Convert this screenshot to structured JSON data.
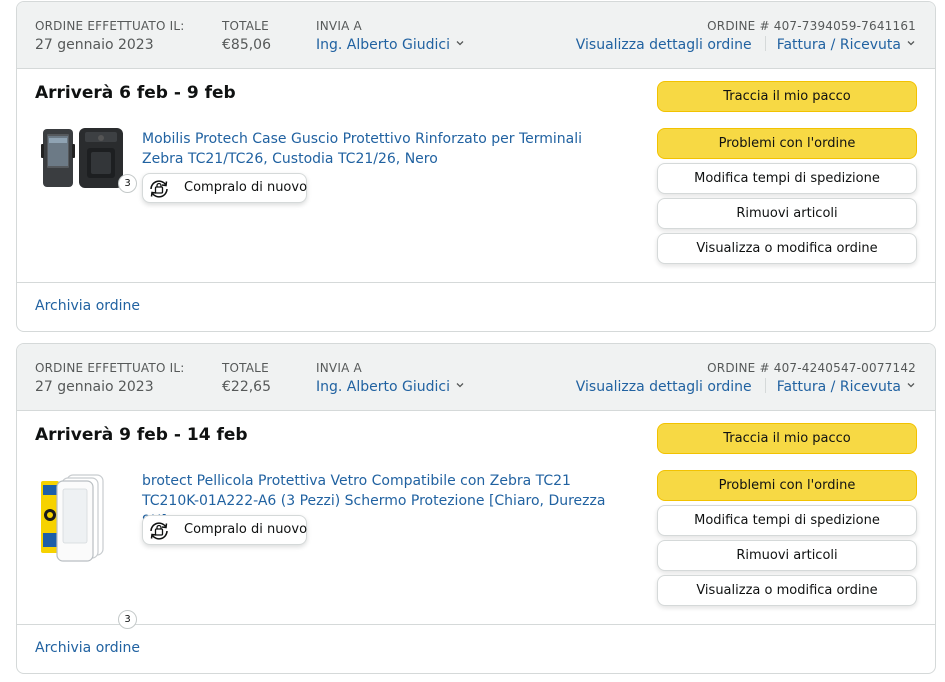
{
  "labels": {
    "order_placed": "ORDINE EFFETTUATO IL:",
    "total": "TOTALE",
    "ship_to": "INVIA A",
    "order_number_prefix": "ORDINE #"
  },
  "orders": [
    {
      "date": "27 gennaio 2023",
      "total": "€85,06",
      "recipient": "Ing. Alberto Giudici",
      "order_number": "ORDINE # 407-7394059-7641161",
      "details_link": "Visualizza dettagli ordine",
      "invoice_link": "Fattura / Ricevuta",
      "arrival": "Arriverà 6 feb - 9 feb",
      "product_title": "Mobilis Protech Case Guscio Protettivo Rinforzato per Terminali Zebra TC21/TC26, Custodia TC21/26, Nero",
      "quantity": "3",
      "buy_again": "Compralo di nuovo",
      "buttons": {
        "track": "Traccia il mio pacco",
        "problems": "Problemi con l'ordine",
        "change_shipping": "Modifica tempi di spedizione",
        "remove_items": "Rimuovi articoli",
        "view_edit": "Visualizza o modifica ordine"
      },
      "archive": "Archivia ordine"
    },
    {
      "date": "27 gennaio 2023",
      "total": "€22,65",
      "recipient": "Ing. Alberto Giudici",
      "order_number": "ORDINE # 407-4240547-0077142",
      "details_link": "Visualizza dettagli ordine",
      "invoice_link": "Fattura / Ricevuta",
      "arrival": "Arriverà 9 feb - 14 feb",
      "product_title": "brotect Pellicola Protettiva Vetro Compatibile con Zebra TC21 TC210K-01A222-A6 (3 Pezzi) Schermo Protezione [Chiaro, Durezza 9H]",
      "quantity": "3",
      "buy_again": "Compralo di nuovo",
      "buttons": {
        "track": "Traccia il mio pacco",
        "problems": "Problemi con l'ordine",
        "change_shipping": "Modifica tempi di spedizione",
        "remove_items": "Rimuovi articoli",
        "view_edit": "Visualizza o modifica ordine"
      },
      "archive": "Archivia ordine"
    }
  ],
  "colors": {
    "link": "#2162a1",
    "header_bg": "#f0f2f2",
    "primary_button": "#f7d944",
    "border": "#d5d9d9"
  },
  "icons": {
    "chevron": "chevron-down-icon",
    "buy_again": "buy-again-icon"
  }
}
